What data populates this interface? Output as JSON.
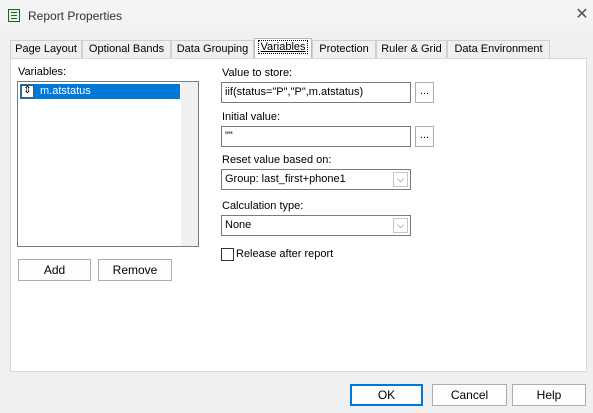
{
  "window": {
    "title": "Report Properties",
    "close_glyph": "✕",
    "icon": "report-app-icon"
  },
  "tabs": [
    "Page Layout",
    "Optional Bands",
    "Data Grouping",
    "Variables",
    "Protection",
    "Ruler & Grid",
    "Data Environment"
  ],
  "active_tab": "Variables",
  "variables": {
    "label": "Variables:",
    "items": [
      "m.atstatus"
    ],
    "selected": "m.atstatus",
    "mover_icon": "⇕",
    "add_label": "Add",
    "remove_label": "Remove"
  },
  "value_to_store": {
    "label": "Value to store:",
    "value": "iif(status=\"P\",\"P\",m.atstatus)",
    "builder_label": "..."
  },
  "initial_value": {
    "label": "Initial value:",
    "value": "\"\"",
    "builder_label": "..."
  },
  "reset": {
    "label": "Reset value based on:",
    "value": "Group: last_first+phone1"
  },
  "calculation": {
    "label": "Calculation type:",
    "value": "None"
  },
  "release": {
    "label": "Release after report",
    "checked": false
  },
  "footer": {
    "ok_label": "OK",
    "cancel_label": "Cancel",
    "help_label": "Help"
  },
  "colors": {
    "selection": "#0078d7",
    "default_button_border": "#0078d7"
  }
}
